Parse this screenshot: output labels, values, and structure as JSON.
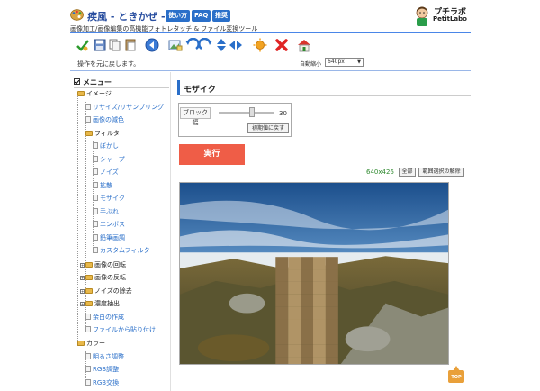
{
  "header": {
    "title": "疾風 - ときかぜ -",
    "subtitle": "画像加工/画像編集の高機能フォトレタッチ & ファイル変換ツール",
    "nav": [
      "使い方",
      "FAQ",
      "推奨"
    ],
    "brand_name": "プチラボ",
    "brand_sub": "PetitLabo"
  },
  "toolbar": {
    "icons": [
      "check-icon",
      "save-icon",
      "copy-icon",
      "paste-icon",
      "back-icon",
      "image-edit-icon",
      "undo-icon",
      "redo-icon",
      "move-vertical-icon",
      "move-horizontal-icon",
      "sun-icon",
      "delete-icon",
      "home-icon"
    ],
    "status_message": "操作を元に戻します。",
    "zoom_label": "自動縮小",
    "zoom_value": "640px"
  },
  "sidebar": {
    "title": "メニュー",
    "items": [
      {
        "label": "イメージ",
        "type": "folder"
      },
      {
        "label": "リサイズ/リサンプリング",
        "type": "link"
      },
      {
        "label": "画像の減色",
        "type": "link"
      },
      {
        "label": "フィルタ",
        "type": "folder"
      },
      {
        "label": "ぼかし",
        "type": "link"
      },
      {
        "label": "シャープ",
        "type": "link"
      },
      {
        "label": "ノイズ",
        "type": "link"
      },
      {
        "label": "拡散",
        "type": "link"
      },
      {
        "label": "モザイク",
        "type": "link"
      },
      {
        "label": "手ぶれ",
        "type": "link"
      },
      {
        "label": "エンボス",
        "type": "link"
      },
      {
        "label": "鉛筆画調",
        "type": "link"
      },
      {
        "label": "カスタムフィルタ",
        "type": "link"
      },
      {
        "label": "画像の回転",
        "type": "collapsed"
      },
      {
        "label": "画像の反転",
        "type": "collapsed"
      },
      {
        "label": "ノイズの除去",
        "type": "collapsed"
      },
      {
        "label": "濃度抽出",
        "type": "collapsed"
      },
      {
        "label": "余白の作成",
        "type": "link"
      },
      {
        "label": "ファイルから貼り付け",
        "type": "link"
      },
      {
        "label": "カラー",
        "type": "folder"
      },
      {
        "label": "明るさ調整",
        "type": "link"
      },
      {
        "label": "RGB調整",
        "type": "link"
      },
      {
        "label": "RGB交換",
        "type": "link"
      }
    ]
  },
  "main": {
    "panel_title": "モザイク",
    "block_size_label": "ブロック幅",
    "block_size_value": "30",
    "block_size_level": 0.6,
    "reset_label": "初期値に戻す",
    "run_label": "実行",
    "image_size": "640x426",
    "select_all_label": "全部",
    "clear_selection_label": "範囲選択の解除",
    "top_label": "TOP"
  },
  "colors": {
    "accent": "#2a6fc9",
    "run_button": "#ef5d47",
    "size_text": "#2f8a2f"
  }
}
